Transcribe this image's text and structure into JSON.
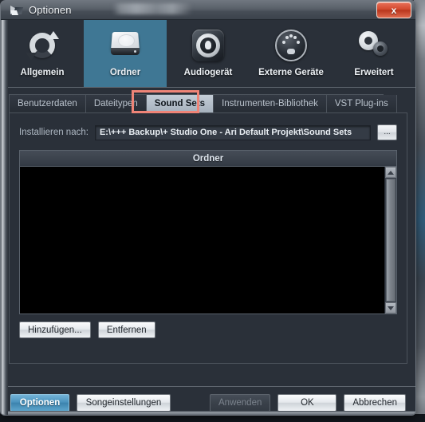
{
  "window": {
    "title": "Optionen",
    "title_icon": "studio-one-logo-icon",
    "redacted_text": "",
    "close_label": "x"
  },
  "toolbar": {
    "items": [
      {
        "label": "Allgemein",
        "icon": "refresh-circular-arrows-icon",
        "selected": false
      },
      {
        "label": "Ordner",
        "icon": "hard-disk-icon",
        "selected": true
      },
      {
        "label": "Audiogerät",
        "icon": "audio-device-knob-icon",
        "selected": false
      },
      {
        "label": "Externe Geräte",
        "icon": "midi-din-connector-icon",
        "selected": false
      },
      {
        "label": "Erweitert",
        "icon": "gears-icon",
        "selected": false
      }
    ]
  },
  "tabs": {
    "items": [
      {
        "label": "Benutzerdaten",
        "active": false
      },
      {
        "label": "Dateitypen",
        "active": false
      },
      {
        "label": "Sound Sets",
        "active": true
      },
      {
        "label": "Instrumenten-Bibliothek",
        "active": false
      },
      {
        "label": "VST Plug-ins",
        "active": false
      }
    ],
    "highlight_color": "#ef8477",
    "highlighted_tab": "Sound Sets"
  },
  "panel": {
    "install_label": "Installieren nach:",
    "install_path": "E:\\+++ Backup\\+ Studio One - Ari Default Projekt\\Sound Sets",
    "install_path_placeholder": "",
    "browse_label": "...",
    "list_header": "Ordner",
    "list_items": [],
    "scrollbar": {
      "up_icon": "caret-up-icon",
      "down_icon": "caret-down-icon"
    },
    "add_label": "Hinzufügen...",
    "remove_label": "Entfernen"
  },
  "footer": {
    "options_label": "Optionen",
    "song_settings_label": "Songeinstellungen",
    "apply_label": "Anwenden",
    "apply_disabled": true,
    "ok_label": "OK",
    "cancel_label": "Abbrechen"
  },
  "colors": {
    "accent_blue": "#4a92bd",
    "toolbar_selected": "#3f7794",
    "annotation_red": "#ef8477",
    "window_bg": "#2a3039",
    "close_red": "#d44a2f"
  }
}
